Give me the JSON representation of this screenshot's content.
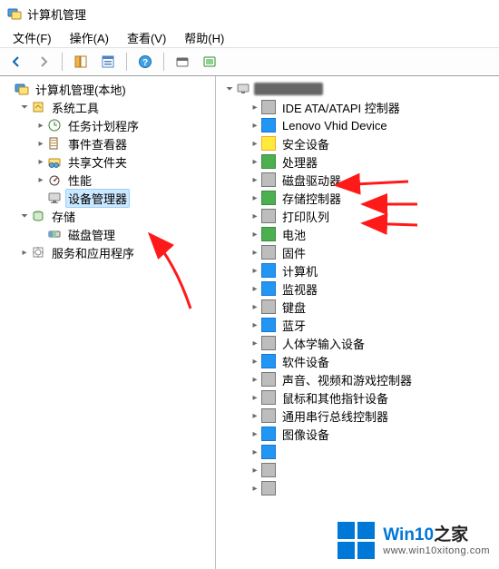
{
  "window_title": "计算机管理",
  "menu": {
    "file": "文件(F)",
    "action": "操作(A)",
    "view": "查看(V)",
    "help": "帮助(H)"
  },
  "toolbar": {
    "back": "back",
    "forward": "forward",
    "up": "up",
    "props": "properties",
    "refresh": "refresh",
    "help": "help"
  },
  "left_tree": {
    "root": "计算机管理(本地)",
    "system_tools": "系统工具",
    "task_scheduler": "任务计划程序",
    "event_viewer": "事件查看器",
    "shared_folders": "共享文件夹",
    "performance": "性能",
    "device_manager": "设备管理器",
    "storage": "存储",
    "disk_management": "磁盘管理",
    "services_apps": "服务和应用程序"
  },
  "right_tree": {
    "ide": "IDE ATA/ATAPI 控制器",
    "lenovo": "Lenovo Vhid Device",
    "security": "安全设备",
    "processor": "处理器",
    "disk_drives": "磁盘驱动器",
    "storage_ctrl": "存储控制器",
    "print_queues": "打印队列",
    "battery": "电池",
    "firmware": "固件",
    "computer": "计算机",
    "monitors": "监视器",
    "keyboards": "键盘",
    "bluetooth": "蓝牙",
    "hid": "人体学输入设备",
    "software_dev": "软件设备",
    "audio": "声音、视频和游戏控制器",
    "mouse": "鼠标和其他指针设备",
    "usb": "通用串行总线控制器",
    "imaging": "图像设备"
  },
  "watermark": {
    "brand_prefix": "Win10",
    "brand_suffix": "之家",
    "url": "www.win10xitong.com"
  }
}
